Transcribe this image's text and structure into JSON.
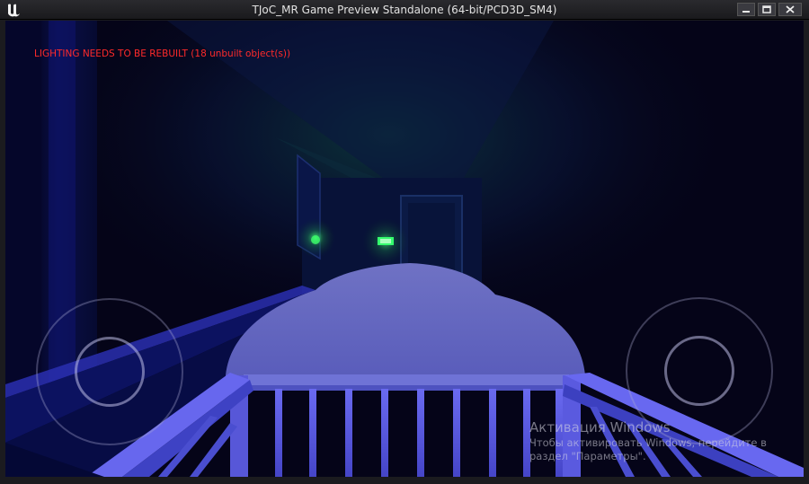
{
  "window": {
    "title": "TJoC_MR Game Preview Standalone (64-bit/PCD3D_SM4)",
    "logo_icon": "unreal-engine-logo-icon",
    "controls": [
      "minimize-icon",
      "maximize-icon",
      "close-icon"
    ]
  },
  "hud": {
    "lighting_warning": "LIGHTING NEEDS TO BE REBUILT (18 unbuilt object(s))",
    "warning_color": "#ff2a2a"
  },
  "controls": {
    "left_joystick": "virtual-joystick-move",
    "right_joystick": "virtual-joystick-look"
  },
  "overlay": {
    "activation_title": "Активация Windows",
    "activation_line1": "Чтобы активировать Windows, перейдите в",
    "activation_line2": "раздел \"Параметры\"."
  },
  "scene": {
    "ambient_color": "#0a0a4a",
    "crib_color": "#5a5ad8",
    "blanket_color": "#6f72c8",
    "light_color": "#3cff6a"
  }
}
